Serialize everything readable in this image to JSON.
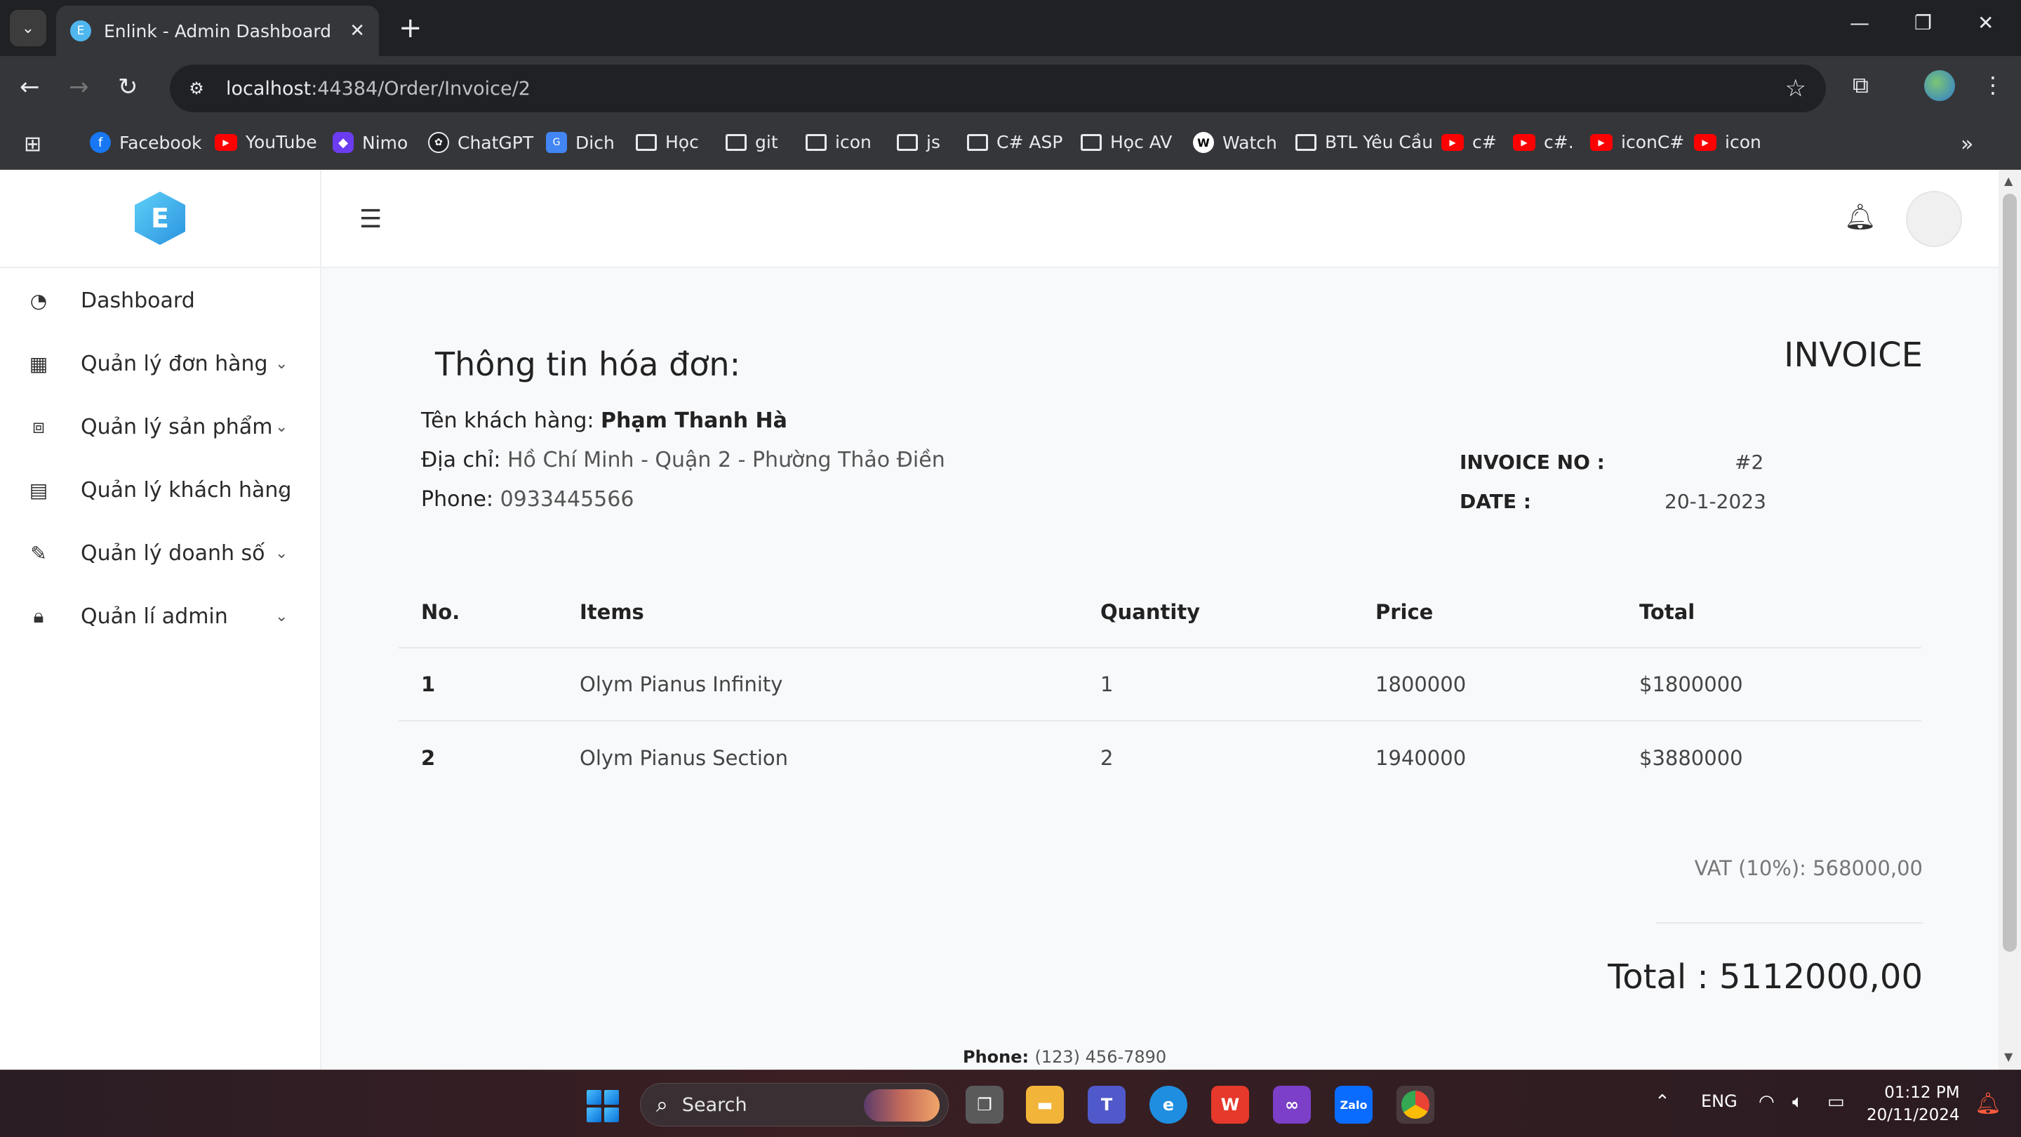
{
  "browser": {
    "tab_title": "Enlink - Admin Dashboard Temp",
    "tab_favicon_letter": "E",
    "url_host": "localhost",
    "url_rest": ":44384/Order/Invoice/2",
    "bookmarks": [
      {
        "label": "Facebook",
        "icon": "facebook-icon"
      },
      {
        "label": "YouTube",
        "icon": "youtube-icon"
      },
      {
        "label": "Nimo",
        "icon": "nimo-icon"
      },
      {
        "label": "ChatGPT",
        "icon": "chatgpt-icon"
      },
      {
        "label": "Dich",
        "icon": "translate-icon"
      },
      {
        "label": "Học",
        "icon": "folder-icon"
      },
      {
        "label": "git",
        "icon": "folder-icon"
      },
      {
        "label": "icon",
        "icon": "folder-icon"
      },
      {
        "label": "js",
        "icon": "folder-icon"
      },
      {
        "label": "C# ASP",
        "icon": "folder-icon"
      },
      {
        "label": "Học AV",
        "icon": "folder-icon"
      },
      {
        "label": "Watch",
        "icon": "watch-icon"
      },
      {
        "label": "BTL Yêu Cầu",
        "icon": "folder-icon"
      },
      {
        "label": "c#",
        "icon": "youtube-icon"
      },
      {
        "label": "c#.",
        "icon": "youtube-icon"
      },
      {
        "label": "iconC#",
        "icon": "youtube-icon"
      },
      {
        "label": "icon",
        "icon": "youtube-icon"
      }
    ]
  },
  "app": {
    "logo_letter": "E",
    "menu": [
      {
        "label": "Dashboard",
        "icon": "dashboard-icon",
        "has_submenu": false
      },
      {
        "label": "Quản lý đơn hàng",
        "icon": "grid-icon",
        "has_submenu": true
      },
      {
        "label": "Quản lý sản phẩm",
        "icon": "boxes-icon",
        "has_submenu": true
      },
      {
        "label": "Quản lý khách hàng",
        "icon": "document-icon",
        "has_submenu": true
      },
      {
        "label": "Quản lý doanh số",
        "icon": "edit-icon",
        "has_submenu": true
      },
      {
        "label": "Quản lí admin",
        "icon": "lock-icon",
        "has_submenu": true
      }
    ]
  },
  "invoice": {
    "heading": "Thông tin hóa đơn:",
    "title": "INVOICE",
    "customer_label": "Tên khách hàng: ",
    "customer_name": "Phạm Thanh Hà",
    "address_label": "Địa chỉ: ",
    "address_value": "Hồ Chí Minh - Quận 2 - Phường Thảo Điền",
    "phone_label": "Phone: ",
    "phone_value": "0933445566",
    "invoice_no_label": "INVOICE NO :",
    "invoice_no_value": "#2",
    "date_label": "DATE :",
    "date_value": "20-1-2023",
    "columns": [
      "No.",
      "Items",
      "Quantity",
      "Price",
      "Total"
    ],
    "rows": [
      {
        "no": "1",
        "item": "Olym Pianus Infinity",
        "quantity": "1",
        "price": "1800000",
        "total": "$1800000"
      },
      {
        "no": "2",
        "item": "Olym Pianus Section",
        "quantity": "2",
        "price": "1940000",
        "total": "$3880000"
      }
    ],
    "vat_text": "VAT (10%): 568000,00",
    "grand_total_text": "Total : 5112000,00",
    "footer_phone_label": "Phone: ",
    "footer_phone_value": "(123) 456-7890"
  },
  "taskbar": {
    "search_label": "Search",
    "language": "ENG",
    "time": "01:12 PM",
    "date": "20/11/2024"
  },
  "colors": {
    "accent": "#2a93e0",
    "page_background": "#f8f9fb",
    "browser_dark": "#202124"
  }
}
